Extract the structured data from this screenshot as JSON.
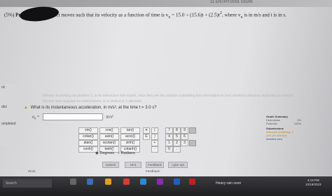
{
  "header": {
    "top_strip": "11 ENTRY.0001 GIDIN"
  },
  "problem": {
    "points": "(5%)",
    "label": "Problem 2:",
    "text": "An object moves such that its velocity as a function of time is v",
    "subscript": "x",
    "equation": "= 15.0 + (15.6)t + (2.5)t",
    "exp": "2",
    "tail": ", where v",
    "tail_sub": "x",
    "tail2": "is in m/s and t is in s."
  },
  "left_panel": {
    "label_a": "ck",
    "label_b": "dict",
    "label_c": "ompleted"
  },
  "faint_lines": {
    "line1": "Otheroe is working on problem 2, in its interactive hint expert, once they are the solution submitting this information to your solutions directory automatic to interact",
    "line2": "Velocity data supplied for submissions, in is limited to 3 attempts"
  },
  "question": {
    "text": "What is its instantaneous acceleration, in m/s², at the time t = 3.0 s?",
    "var": "a",
    "var_sub": "x",
    "eq": "=",
    "unit": "m/s²"
  },
  "calculator": {
    "funcs": [
      "sin()",
      "cos()",
      "tan()",
      "cotan()",
      "asin()",
      "acos()",
      "atan()",
      "acotan()",
      "sinh()",
      "cosh()",
      "tanh()",
      "cotanh()"
    ],
    "consts": [
      "π",
      "(",
      "E",
      ")",
      "",
      "",
      "",
      ""
    ],
    "digits": [
      "7",
      "8",
      "9",
      "4",
      "5",
      "6",
      "1",
      "2",
      "3",
      "0",
      ".",
      "+",
      "-"
    ],
    "degrees": "Degrees",
    "radians": "Radians"
  },
  "buttons": {
    "submit": "Submit",
    "hint": "Hint",
    "feedback_btn": "Feedback",
    "give_up": "I give up!"
  },
  "footer": {
    "hints": "Hints:",
    "feedback": "Feedback:"
  },
  "grade": {
    "title": "Grade Summary",
    "deductions": "Deductions",
    "deductions_val": "0%",
    "potential": "Potential",
    "potential_val": "100%",
    "submissions": "Submissions",
    "attempts": "Attempts remaining: 5",
    "per_attempt": "(0% per attempt)",
    "detailed": "detailed view"
  },
  "taskbar": {
    "search": "Search",
    "weather": "Heavy rain soon",
    "time": "4:19 PM",
    "date": "10/19/2023"
  }
}
